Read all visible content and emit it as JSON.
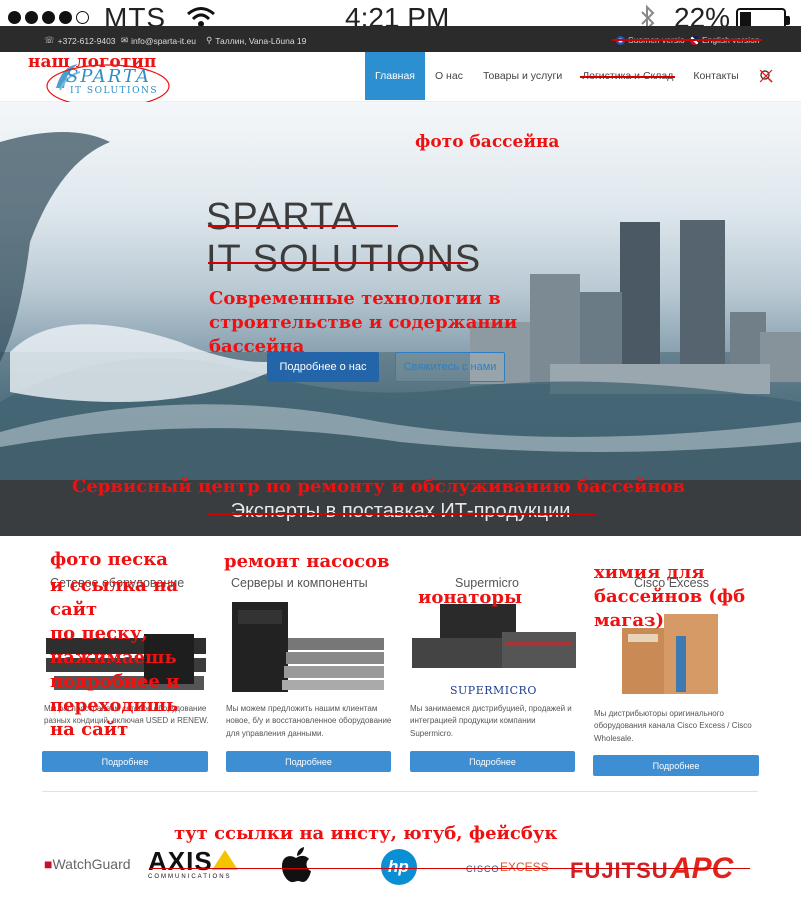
{
  "status_bar": {
    "carrier": "MTS",
    "time": "4:21 PM",
    "battery": "22%"
  },
  "top_bar": {
    "phone": "+372-612-9403",
    "email": "info@sparta-it.eu",
    "address": "Таллин, Vana-Lõuna 19",
    "lang_finnish": "Suomen versio",
    "lang_english": "English version"
  },
  "header": {
    "logo_line1": "SPARTA",
    "logo_line2": "IT SOLUTIONS",
    "nav": [
      "Главная",
      "О нас",
      "Товары и услуги",
      "Логистика и Склад",
      "Контакты"
    ]
  },
  "hero": {
    "title_line1": "SPARTA",
    "title_line2": "IT SOLUTIONS",
    "subtitle": "Современные технологии в",
    "btn_more": "Подробнее о нас",
    "btn_contact": "Свяжитесь с нами"
  },
  "band": {
    "text": "Эксперты в поставках ИТ-продукции"
  },
  "products": [
    {
      "title": "Сетевое оборудование",
      "text": "Мы распространяем сетевое оборудование разных кондиций, включая USED и RENEW.",
      "button": "Подробнее"
    },
    {
      "title": "Серверы и компоненты",
      "text": "Мы можем предложить нашим клиентам новое, б/у и восстановленное оборудование для управления данными.",
      "button": "Подробнее"
    },
    {
      "title": "Supermicro",
      "text": "Мы занимаемся дистрибуцией, продажей и интеграцией продукции компании Supermicro.",
      "button": "Подробнее",
      "logo": "SUPERMICRO"
    },
    {
      "title": "Cisco Excess",
      "text": "Мы дистрибьюторы оригинального оборудования канала Cisco Excess / Cisco Wholesale.",
      "button": "Подробнее"
    }
  ],
  "brands": {
    "watchguard": "WatchGuard",
    "axis": "AXIS",
    "axis_sub": "COMMUNICATIONS",
    "hp": "hp",
    "cisco": "CISCO",
    "excess": "EXCESS",
    "fujitsu": "FUJITSU",
    "apc": "APC"
  },
  "annotations": {
    "logo_note": "наш логотип",
    "pool_photo": "фото бассейна",
    "hero_line1": "Современные технологии в",
    "hero_line2": "строительстве и содержании",
    "hero_line3": "бассейна",
    "service_center": "Сервисный центр по ремонту и обслуживанию бассейнов",
    "sand_lines": [
      "фото песка",
      "и ссылка на",
      "сайт",
      "по песку,",
      "нажимаешь",
      "подробнее и",
      "переходишь",
      "на сайт"
    ],
    "pump_repair": "ремонт насосов",
    "ionizers": "ионаторы",
    "chem_lines": [
      "химия для",
      "бассейнов (фб",
      "магаз)"
    ],
    "social_links": "тут ссылки на инсту, ютуб, фейсбук"
  },
  "colors": {
    "accent": "#2c8fcf",
    "annotation": "#ee1111",
    "topbar": "#2b2b2b",
    "band": "#3a3d40"
  }
}
